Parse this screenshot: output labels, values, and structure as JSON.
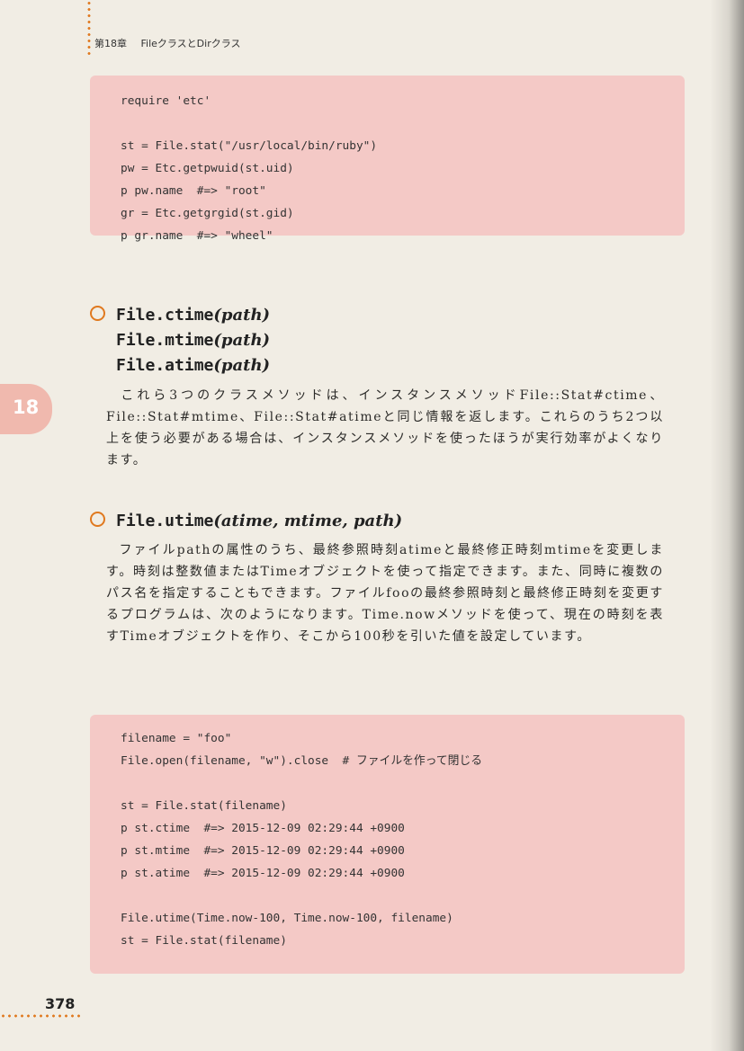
{
  "header": {
    "chapter": "第18章",
    "title": "FileクラスとDirクラス"
  },
  "side_tab": "18",
  "code_block_1": [
    "require 'etc'",
    "",
    "st = File.stat(\"/usr/local/bin/ruby\")",
    "pw = Etc.getpwuid(st.uid)",
    "p pw.name  #=> \"root\"",
    "gr = Etc.getgrgid(st.gid)",
    "p gr.name  #=> \"wheel\""
  ],
  "section_times": {
    "line1_name": "File.ctime",
    "line2_name": "File.mtime",
    "line3_name": "File.atime",
    "args": "(path)",
    "paragraph": "これら3つのクラスメソッドは、インスタンスメソッドFile::Stat#ctime、File::Stat#mtime、File::Stat#atimeと同じ情報を返します。これらのうち2つ以上を使う必要がある場合は、インスタンスメソッドを使ったほうが実行効率がよくなります。"
  },
  "section_utime": {
    "name": "File.utime",
    "args": "(atime, mtime, path)",
    "paragraph": "ファイルpathの属性のうち、最終参照時刻atimeと最終修正時刻mtimeを変更します。時刻は整数値またはTimeオブジェクトを使って指定できます。また、同時に複数のパス名を指定することもできます。ファイルfooの最終参照時刻と最終修正時刻を変更するプログラムは、次のようになります。Time.nowメソッドを使って、現在の時刻を表すTimeオブジェクトを作り、そこから100秒を引いた値を設定しています。"
  },
  "code_block_2": [
    "filename = \"foo\"",
    "File.open(filename, \"w\").close  # ファイルを作って閉じる",
    "",
    "st = File.stat(filename)",
    "p st.ctime  #=> 2015-12-09 02:29:44 +0900",
    "p st.mtime  #=> 2015-12-09 02:29:44 +0900",
    "p st.atime  #=> 2015-12-09 02:29:44 +0900",
    "",
    "File.utime(Time.now-100, Time.now-100, filename)",
    "st = File.stat(filename)"
  ],
  "page_number": "378",
  "colors": {
    "accent": "#e0791f",
    "code_bg": "#f4c9c6",
    "tab_bg": "#f0b9ae",
    "paper": "#f1ede4"
  }
}
